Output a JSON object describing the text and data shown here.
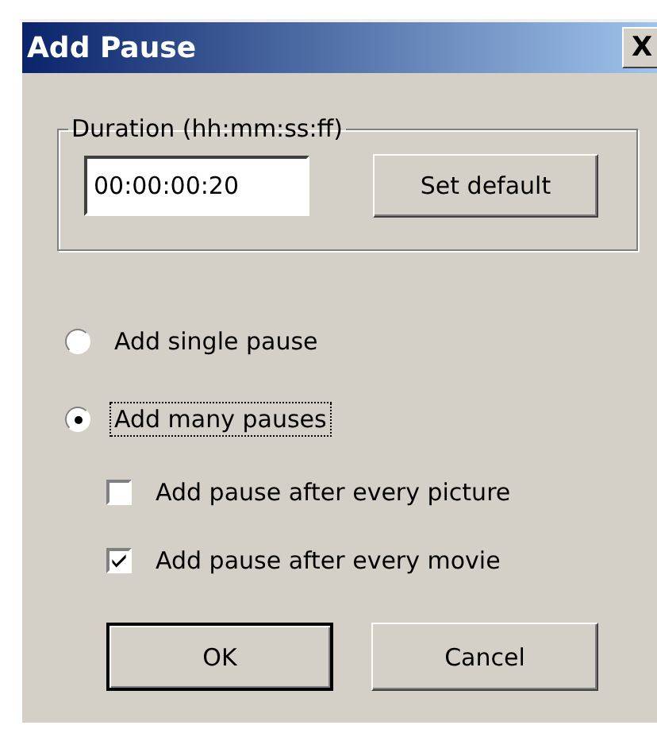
{
  "window": {
    "title": "Add Pause",
    "close": "X"
  },
  "duration": {
    "legend": "Duration (hh:mm:ss:ff)",
    "value": "00:00:00:20",
    "button": "Set default"
  },
  "radios": [
    {
      "label": "Add single pause",
      "selected": false,
      "focused": false
    },
    {
      "label": "Add many pauses",
      "selected": true,
      "focused": true
    }
  ],
  "checkboxes": [
    {
      "label": "Add pause after every picture",
      "checked": false
    },
    {
      "label": "Add pause after every movie",
      "checked": true
    }
  ],
  "buttons": [
    {
      "label": "OK",
      "default": true
    },
    {
      "label": "Cancel",
      "default": false
    }
  ]
}
